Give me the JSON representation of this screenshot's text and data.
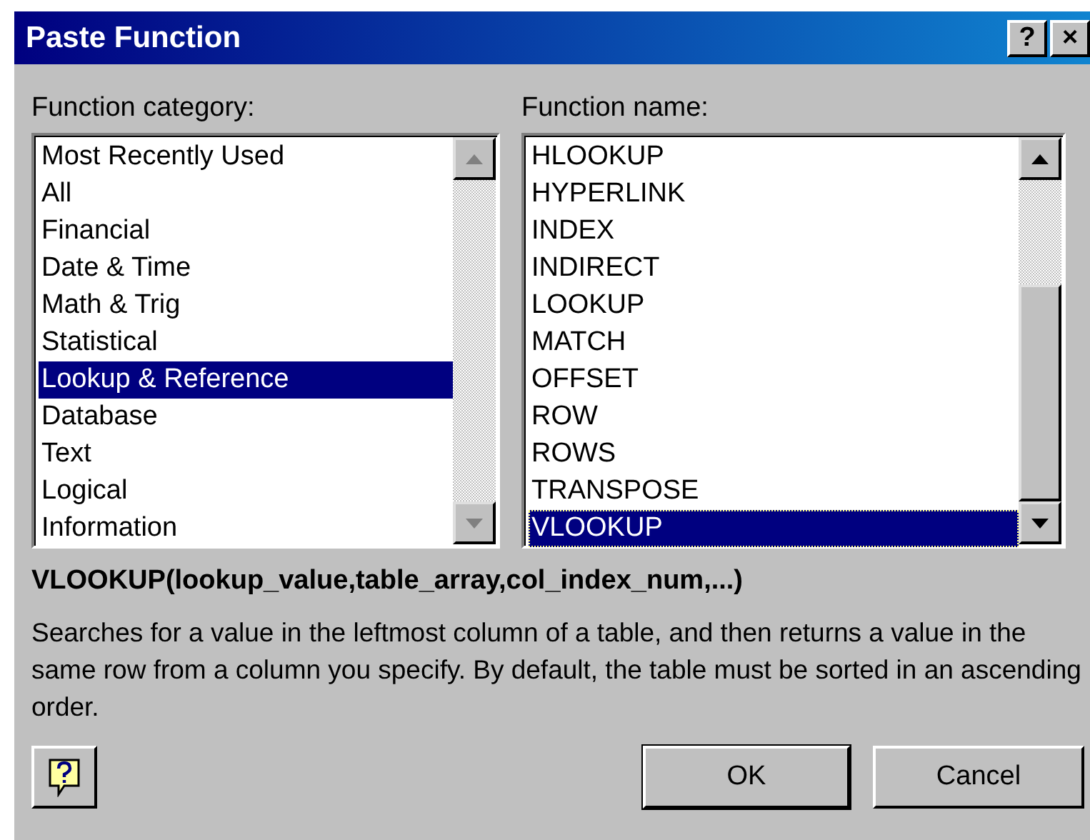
{
  "window": {
    "title": "Paste Function",
    "title_buttons": [
      "?",
      "×"
    ]
  },
  "category_list": {
    "label": "Function category:",
    "items": [
      {
        "label": "Most Recently Used",
        "selected": false
      },
      {
        "label": "All",
        "selected": false
      },
      {
        "label": "Financial",
        "selected": false
      },
      {
        "label": "Date & Time",
        "selected": false
      },
      {
        "label": "Math & Trig",
        "selected": false
      },
      {
        "label": "Statistical",
        "selected": false
      },
      {
        "label": "Lookup & Reference",
        "selected": true
      },
      {
        "label": "Database",
        "selected": false
      },
      {
        "label": "Text",
        "selected": false
      },
      {
        "label": "Logical",
        "selected": false
      },
      {
        "label": "Information",
        "selected": false
      }
    ]
  },
  "function_list": {
    "label": "Function name:",
    "items": [
      {
        "label": "HLOOKUP",
        "selected": false
      },
      {
        "label": "HYPERLINK",
        "selected": false
      },
      {
        "label": "INDEX",
        "selected": false
      },
      {
        "label": "INDIRECT",
        "selected": false
      },
      {
        "label": "LOOKUP",
        "selected": false
      },
      {
        "label": "MATCH",
        "selected": false
      },
      {
        "label": "OFFSET",
        "selected": false
      },
      {
        "label": "ROW",
        "selected": false
      },
      {
        "label": "ROWS",
        "selected": false
      },
      {
        "label": "TRANSPOSE",
        "selected": false
      },
      {
        "label": "VLOOKUP",
        "selected": true
      }
    ]
  },
  "syntax": "VLOOKUP(lookup_value,table_array,col_index_num,...)",
  "description": "Searches for a value in the leftmost column of a table, and then returns a value in the same row from a column you specify. By default, the table must be sorted in an ascending order.",
  "buttons": [
    "OK",
    "Cancel"
  ]
}
